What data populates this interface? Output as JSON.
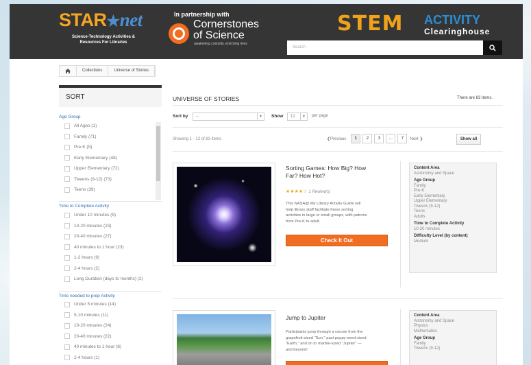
{
  "header": {
    "starnet_logo_left": "STAR",
    "starnet_logo_star": "★",
    "starnet_logo_right": "net",
    "starnet_sub_1": "Science-Technology Activities &",
    "starnet_sub_2": "Resources For Libraries",
    "partner_label": "In partnership with",
    "cos_title_1": "Cornerstones",
    "cos_title_2": "of Science",
    "cos_tagline": "awakening curiosity, enriching lives",
    "stem_word": "STEM",
    "activity_word": "ACTIVITY",
    "clearinghouse_word": "Clearinghouse",
    "search_placeholder": "Search"
  },
  "breadcrumb": [
    "Collections",
    "Universe of Stories"
  ],
  "sidebar": {
    "sort_title": "SORT",
    "age_group": {
      "title": "Age Group",
      "items": [
        "All Ages (1)",
        "Family (71)",
        "Pre-K (9)",
        "Early Elementary (48)",
        "Upper Elementary (72)",
        "Tweens (9-12) (73)",
        "Teens (39)"
      ]
    },
    "time_complete": {
      "title": "Time to Complete Activity",
      "items": [
        "Under 10 minutes (9)",
        "10-20 minutes (23)",
        "20-40 minutes (27)",
        "40 minutes to 1 hour (23)",
        "1-2 hours (9)",
        "2-4 hours (2)",
        "Long Duration (days to months) (2)"
      ]
    },
    "time_prep": {
      "title": "Time needed to prep Activity",
      "items": [
        "Under 5 minutes (14)",
        "5-10 minutes (11)",
        "10-20 minutes (24)",
        "20-40 minutes (22)",
        "40 minutes to 1 hour (8)",
        "2-4 hours (1)"
      ]
    }
  },
  "main": {
    "title": "UNIVERSE OF STORIES",
    "item_count": "There are 83 items.",
    "sort_by_label": "Sort by",
    "sort_by_value": "--",
    "show_label": "Show",
    "show_value": "12",
    "per_page": "per page",
    "showing": "Showing 1 - 12 of 83 items",
    "pager": {
      "previous": "Previous",
      "pages": [
        "1",
        "2",
        "3",
        "...",
        "7"
      ],
      "next": "Next",
      "show_all": "Show all"
    },
    "products": [
      {
        "title_1": "Sorting Games: How Big? How",
        "title_2": "Far? How Hot?",
        "stars": "★★★★☆",
        "reviews": "1 Review(s)",
        "desc": [
          "This NASA@ My Library Activity Guide will",
          "help library staff facilitate these sorting",
          "activities in large or small groups, with patrons",
          "from Pre-K to adult."
        ],
        "cta": "Check It Out",
        "meta": [
          {
            "h": "Content Area",
            "v": [
              "Astronomy and Space"
            ]
          },
          {
            "h": "Age Group",
            "v": [
              "Family",
              "Pre-K",
              "Early Elementary",
              "Upper Elementary",
              "Tweens (9-12)",
              "Teens",
              "Adults"
            ]
          },
          {
            "h": "Time to Complete Activity",
            "v": [
              "10-20 minutes"
            ]
          },
          {
            "h": "Difficulty Level (by content)",
            "v": [
              "Medium"
            ]
          }
        ]
      },
      {
        "title_1": "Jump to Jupiter",
        "desc": [
          "Participants jump through a course from the",
          "grapefruit-sized \"Sun,\" past poppy-seed-sized",
          "\"Earth,\" and on to marble-sized \"Jupiter\" —",
          "and beyond!"
        ],
        "meta": [
          {
            "h": "Content Area",
            "v": [
              "Astronomy and Space",
              "Physics",
              "Mathematics"
            ]
          },
          {
            "h": "Age Group",
            "v": [
              "Family",
              "Tweens (9-12)"
            ]
          }
        ]
      }
    ]
  },
  "colors": {
    "accent": "#f06d22",
    "header_bg": "#353535",
    "link": "#2a6fb1",
    "star": "#f0a21a"
  }
}
